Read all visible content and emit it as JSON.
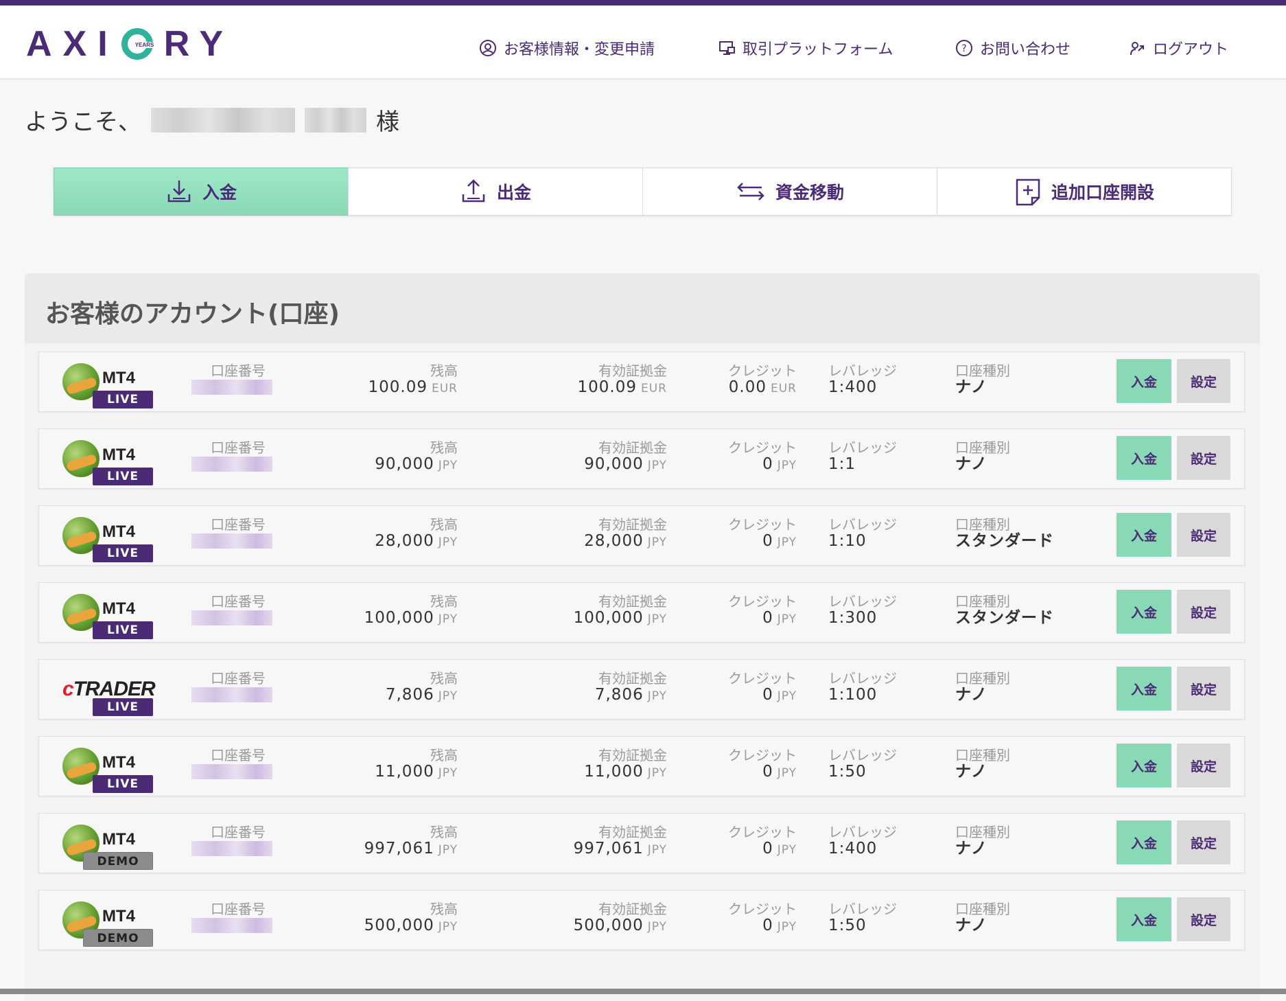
{
  "colors": {
    "brand": "#4b2a76",
    "accent_green": "#8ad9b6",
    "logo_ring": "#2fb39a"
  },
  "logo": {
    "letters_left": "AX",
    "letter_i": "I",
    "years": "YEARS",
    "letters_right": "RY"
  },
  "nav": [
    {
      "label": "お客様情報・変更申請",
      "icon": "user-circle-icon"
    },
    {
      "label": "取引プラットフォーム",
      "icon": "monitor-icon"
    },
    {
      "label": "お問い合わせ",
      "icon": "question-icon"
    },
    {
      "label": "ログアウト",
      "icon": "logout-icon"
    }
  ],
  "welcome": {
    "prefix": "ようこそ、",
    "suffix": "様"
  },
  "actions": [
    {
      "label": "入金",
      "icon": "download-icon",
      "active": true
    },
    {
      "label": "出金",
      "icon": "upload-icon",
      "active": false
    },
    {
      "label": "資金移動",
      "icon": "transfer-arrows-icon",
      "active": false
    },
    {
      "label": "追加口座開設",
      "icon": "add-document-icon",
      "active": false
    }
  ],
  "accounts": {
    "title": "お客様のアカウント(口座)",
    "labels": {
      "account_no": "口座番号",
      "balance": "残高",
      "equity": "有効証拠金",
      "credit": "クレジット",
      "leverage": "レバレッジ",
      "type": "口座種別"
    },
    "deposit_button": "入金",
    "settings_button": "設定",
    "rows": [
      {
        "platform": "MT4",
        "tag": "LIVE",
        "balance": "100.09",
        "balance_cur": "EUR",
        "equity": "100.09",
        "equity_cur": "EUR",
        "credit": "0.00",
        "credit_cur": "EUR",
        "leverage": "1:400",
        "type": "ナノ"
      },
      {
        "platform": "MT4",
        "tag": "LIVE",
        "balance": "90,000",
        "balance_cur": "JPY",
        "equity": "90,000",
        "equity_cur": "JPY",
        "credit": "0",
        "credit_cur": "JPY",
        "leverage": "1:1",
        "type": "ナノ"
      },
      {
        "platform": "MT4",
        "tag": "LIVE",
        "balance": "28,000",
        "balance_cur": "JPY",
        "equity": "28,000",
        "equity_cur": "JPY",
        "credit": "0",
        "credit_cur": "JPY",
        "leverage": "1:10",
        "type": "スタンダード"
      },
      {
        "platform": "MT4",
        "tag": "LIVE",
        "balance": "100,000",
        "balance_cur": "JPY",
        "equity": "100,000",
        "equity_cur": "JPY",
        "credit": "0",
        "credit_cur": "JPY",
        "leverage": "1:300",
        "type": "スタンダード"
      },
      {
        "platform": "cTRADER",
        "tag": "LIVE",
        "balance": "7,806",
        "balance_cur": "JPY",
        "equity": "7,806",
        "equity_cur": "JPY",
        "credit": "0",
        "credit_cur": "JPY",
        "leverage": "1:100",
        "type": "ナノ"
      },
      {
        "platform": "MT4",
        "tag": "LIVE",
        "balance": "11,000",
        "balance_cur": "JPY",
        "equity": "11,000",
        "equity_cur": "JPY",
        "credit": "0",
        "credit_cur": "JPY",
        "leverage": "1:50",
        "type": "ナノ"
      },
      {
        "platform": "MT4",
        "tag": "DEMO",
        "balance": "997,061",
        "balance_cur": "JPY",
        "equity": "997,061",
        "equity_cur": "JPY",
        "credit": "0",
        "credit_cur": "JPY",
        "leverage": "1:400",
        "type": "ナノ"
      },
      {
        "platform": "MT4",
        "tag": "DEMO",
        "balance": "500,000",
        "balance_cur": "JPY",
        "equity": "500,000",
        "equity_cur": "JPY",
        "credit": "0",
        "credit_cur": "JPY",
        "leverage": "1:50",
        "type": "ナノ"
      }
    ]
  }
}
